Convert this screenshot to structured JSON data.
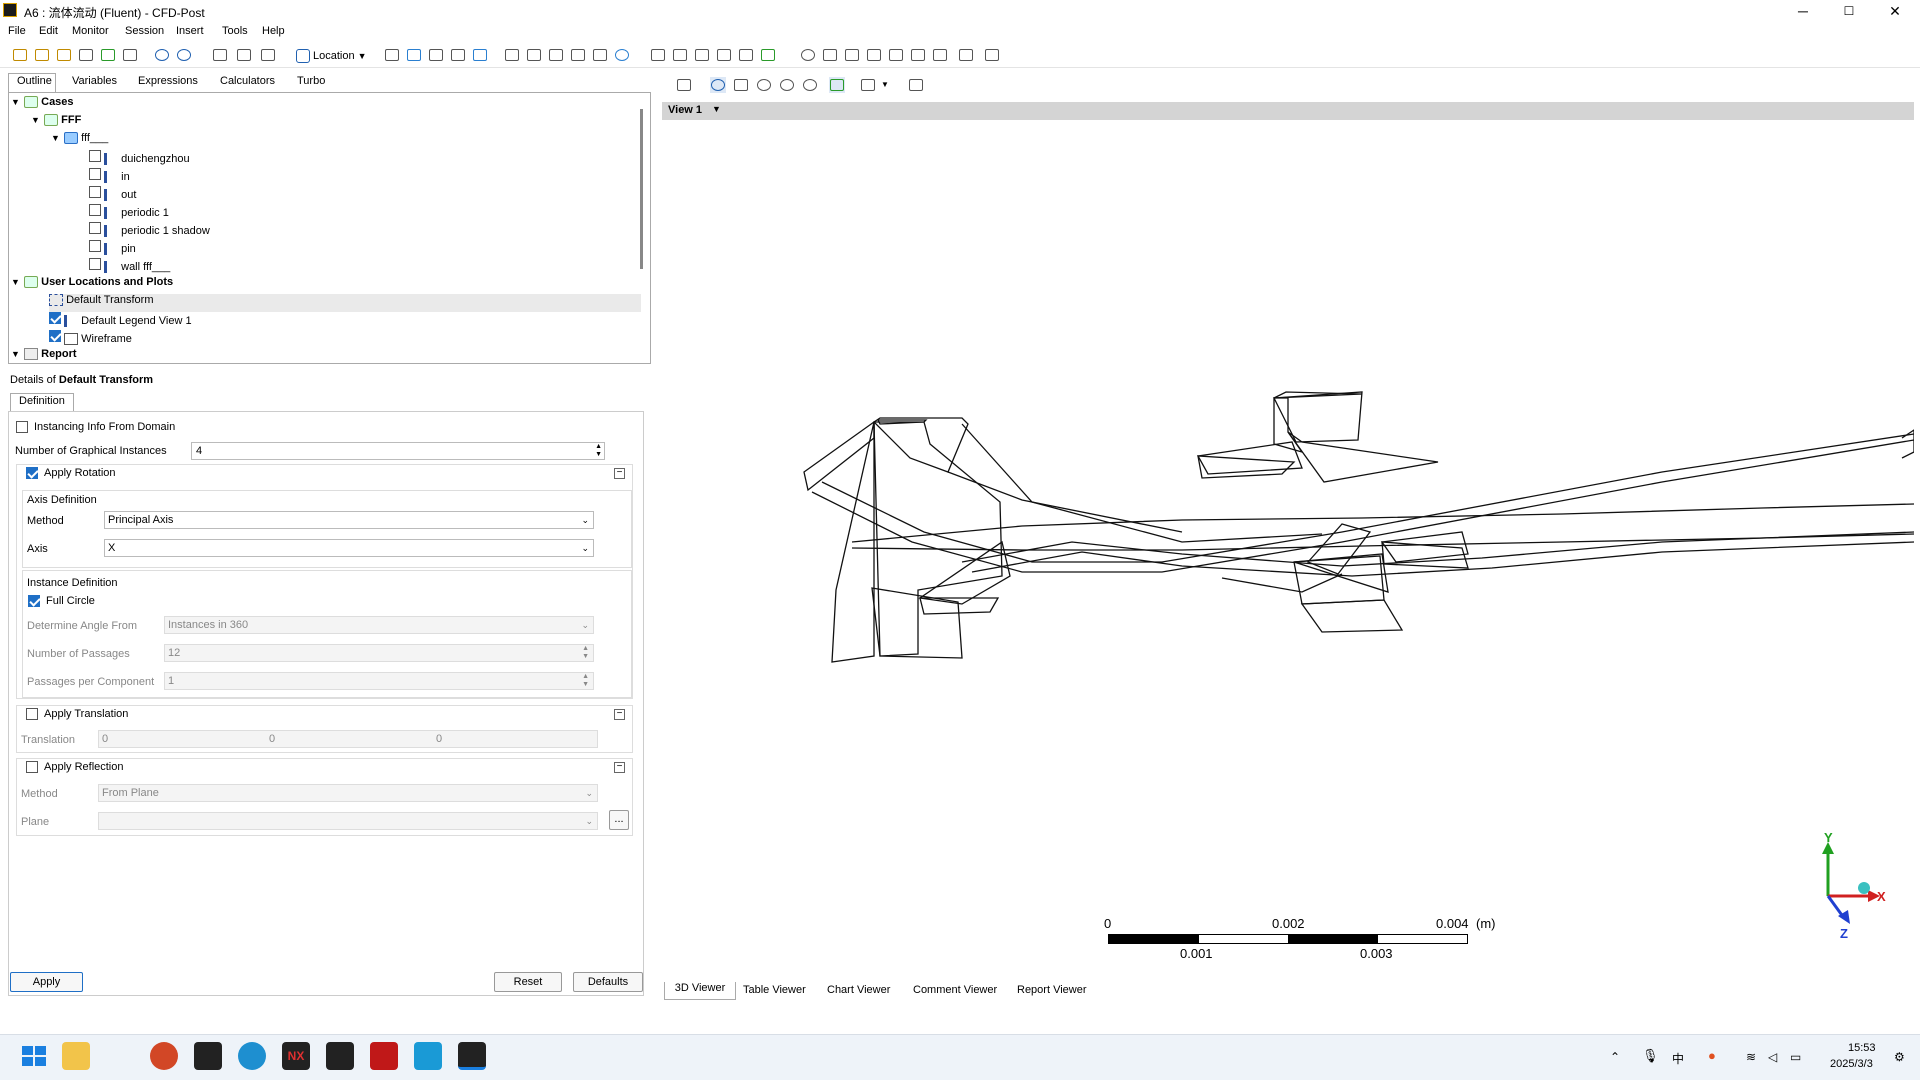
{
  "window": {
    "title": "A6 : 流体流动 (Fluent)  - CFD-Post",
    "minimize": "─",
    "maximize": "☐",
    "close": "✕"
  },
  "menu": [
    "File",
    "Edit",
    "Monitor",
    "Session",
    "Insert",
    "Tools",
    "Help"
  ],
  "toolbar": {
    "location_label": "Location"
  },
  "left_tabs": [
    "Outline",
    "Variables",
    "Expressions",
    "Calculators",
    "Turbo"
  ],
  "tree": {
    "cases": "Cases",
    "fff_case": "FFF",
    "fff_domain": "fff___",
    "regions": [
      "duichengzhou",
      "in",
      "out",
      "periodic 1",
      "periodic 1 shadow",
      "pin",
      "wall fff___"
    ],
    "user_locations": "User Locations and Plots",
    "default_transform": "Default Transform",
    "default_legend": "Default Legend View 1",
    "wireframe": "Wireframe",
    "report": "Report"
  },
  "details": {
    "header_prefix": "Details of ",
    "header_object": "Default Transform",
    "tab": "Definition",
    "instancing_info": "Instancing Info From Domain",
    "num_instances_label": "Number of Graphical Instances",
    "num_instances_value": "4",
    "apply_rotation": "Apply Rotation",
    "axis_definition": "Axis Definition",
    "method_label": "Method",
    "method_value": "Principal Axis",
    "axis_label": "Axis",
    "axis_value": "X",
    "instance_definition": "Instance Definition",
    "full_circle": "Full Circle",
    "determine_angle_label": "Determine Angle From",
    "determine_angle_value": "Instances in 360",
    "num_passages_label": "Number of Passages",
    "num_passages_value": "12",
    "passages_per_comp_label": "Passages per Component",
    "passages_per_comp_value": "1",
    "apply_translation": "Apply Translation",
    "translation_label": "Translation",
    "translation_values": [
      "0",
      "0",
      "0"
    ],
    "apply_reflection": "Apply Reflection",
    "refl_method_label": "Method",
    "refl_method_value": "From Plane",
    "plane_label": "Plane",
    "plane_value": "",
    "ellipsis": "...",
    "apply_btn": "Apply",
    "reset_btn": "Reset",
    "defaults_btn": "Defaults"
  },
  "viewer": {
    "view_label": "View 1",
    "scale_top": [
      "0",
      "0.002",
      "0.004",
      "(m)"
    ],
    "scale_bottom": [
      "0.001",
      "0.003"
    ],
    "axes": {
      "x": "X",
      "y": "Y",
      "z": "Z"
    },
    "bottom_tabs": [
      "3D Viewer",
      "Table Viewer",
      "Chart Viewer",
      "Comment Viewer",
      "Report Viewer"
    ]
  },
  "taskbar": {
    "time": "15:53",
    "date": "2025/3/3",
    "apps": [
      "start",
      "file-explorer",
      "powerpoint",
      "workbench",
      "edge",
      "nx",
      "fluent",
      "acrobat",
      "app-bird",
      "cfd-post"
    ]
  },
  "colors": {
    "accent": "#1f6fc6",
    "x_axis": "#d02020",
    "y_axis": "#20a020",
    "z_axis": "#2040d0"
  }
}
